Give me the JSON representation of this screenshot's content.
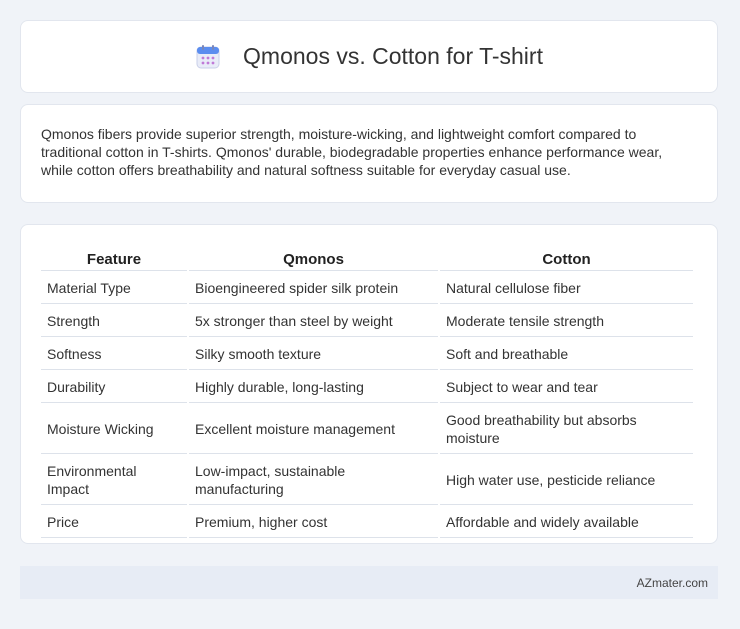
{
  "header": {
    "title": "Qmonos vs. Cotton for T-shirt",
    "icon": "calendar-icon",
    "accent_color": "#5b8def"
  },
  "summary": {
    "text": "Qmonos fibers provide superior strength, moisture-wicking, and lightweight comfort compared to traditional cotton in T-shirts. Qmonos' durable, biodegradable properties enhance performance wear, while cotton offers breathability and natural softness suitable for everyday casual use."
  },
  "table": {
    "headers": [
      "Feature",
      "Qmonos",
      "Cotton"
    ],
    "rows": [
      [
        "Material Type",
        "Bioengineered spider silk protein",
        "Natural cellulose fiber"
      ],
      [
        "Strength",
        "5x stronger than steel by weight",
        "Moderate tensile strength"
      ],
      [
        "Softness",
        "Silky smooth texture",
        "Soft and breathable"
      ],
      [
        "Durability",
        "Highly durable, long-lasting",
        "Subject to wear and tear"
      ],
      [
        "Moisture Wicking",
        "Excellent moisture management",
        "Good breathability but absorbs moisture"
      ],
      [
        "Environmental Impact",
        "Low-impact, sustainable manufacturing",
        "High water use, pesticide reliance"
      ],
      [
        "Price",
        "Premium, higher cost",
        "Affordable and widely available"
      ]
    ]
  },
  "footer": {
    "brand": "AZmater.com"
  }
}
